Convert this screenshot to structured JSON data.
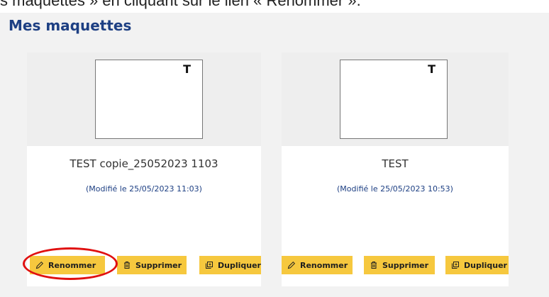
{
  "intro_text": "s maquettes » en cliquant sur le lien « Renommer ».",
  "section_title": "Mes maquettes",
  "cards": [
    {
      "thumbnail_letter": "T",
      "title": "TEST copie_25052023 1103",
      "modified": "(Modifié le 25/05/2023 11:03)",
      "rename_label": "Renommer",
      "delete_label": "Supprimer",
      "duplicate_label": "Dupliquer"
    },
    {
      "thumbnail_letter": "T",
      "title": "TEST",
      "modified": "(Modifié le 25/05/2023 10:53)",
      "rename_label": "Renommer",
      "delete_label": "Supprimer",
      "duplicate_label": "Dupliquer"
    }
  ],
  "colors": {
    "heading": "#1d3f83",
    "button_bg": "#f6c83e",
    "highlight": "#e01010",
    "panel_bg": "#f2f2f2"
  },
  "icons": {
    "rename": "pencil-icon",
    "delete": "trash-icon",
    "duplicate": "duplicate-icon"
  }
}
